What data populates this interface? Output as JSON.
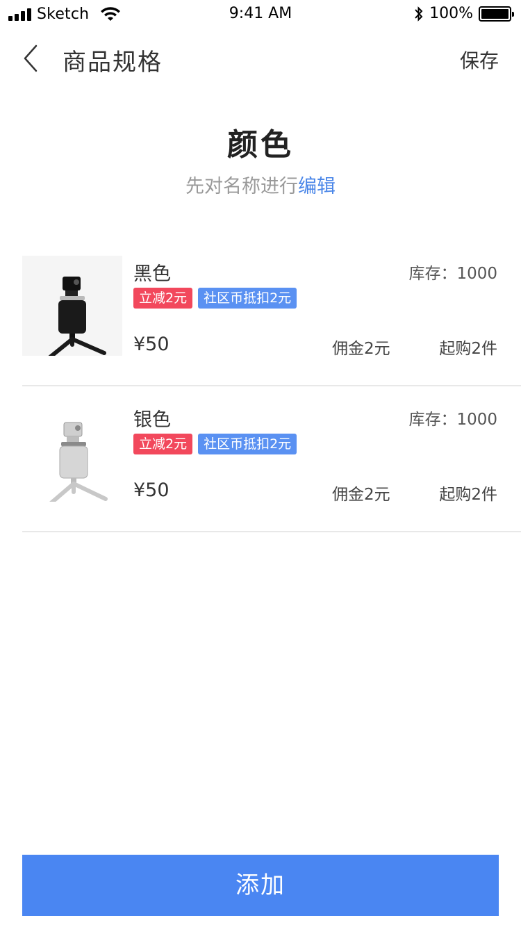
{
  "status_bar": {
    "carrier": "Sketch",
    "time": "9:41 AM",
    "battery": "100%",
    "battery_level": 1.0
  },
  "nav": {
    "title": "商品规格",
    "save_label": "保存",
    "back_icon": "chevron-left-icon"
  },
  "spec": {
    "title": "颜色",
    "hint_prefix": "先对名称进行",
    "hint_link": "编辑"
  },
  "items": [
    {
      "name": "黑色",
      "stock": "库存：1000",
      "tags": [
        "立减2元",
        "社区币抵扣2元"
      ],
      "price": "¥50",
      "commission": "佣金2元",
      "min_buy": "起购2件",
      "image": "black-tripod-camera-icon"
    },
    {
      "name": "银色",
      "stock": "库存：1000",
      "tags": [
        "立减2元",
        "社区币抵扣2元"
      ],
      "price": "¥50",
      "commission": "佣金2元",
      "min_buy": "起购2件",
      "image": "silver-tripod-camera-icon"
    }
  ],
  "footer": {
    "add_label": "添加"
  },
  "colors": {
    "accent": "#4a86f2",
    "link": "#4a86e8",
    "tag_red": "#f2485c",
    "tag_blue": "#5a91f2"
  }
}
